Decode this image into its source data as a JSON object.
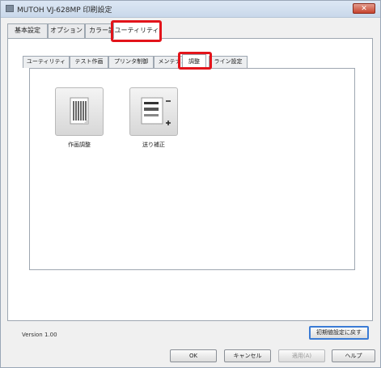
{
  "window": {
    "title": "MUTOH VJ-628MP 印刷設定",
    "close_label": "✕"
  },
  "main_tabs": [
    {
      "label": "基本設定"
    },
    {
      "label": "オプション"
    },
    {
      "label": "カラー調"
    },
    {
      "label": "ユーティリティ"
    }
  ],
  "sub_tabs": [
    {
      "label": "ユーティリティ"
    },
    {
      "label": "テスト作画"
    },
    {
      "label": "プリンタ制御"
    },
    {
      "label": "メンテナン"
    },
    {
      "label": "調整"
    },
    {
      "label": "ライン設定"
    }
  ],
  "tools": [
    {
      "label": "作画調整",
      "icon": "print-adjust-icon"
    },
    {
      "label": "送り補正",
      "icon": "feed-correction-icon"
    }
  ],
  "version": "Version 1.00",
  "buttons": {
    "restore_defaults": "初期値設定に戻す",
    "ok": "OK",
    "cancel": "キャンセル",
    "apply": "適用(A)",
    "help": "ヘルプ"
  },
  "colors": {
    "highlight": "#e3141b",
    "accent": "#3a7bd5"
  }
}
